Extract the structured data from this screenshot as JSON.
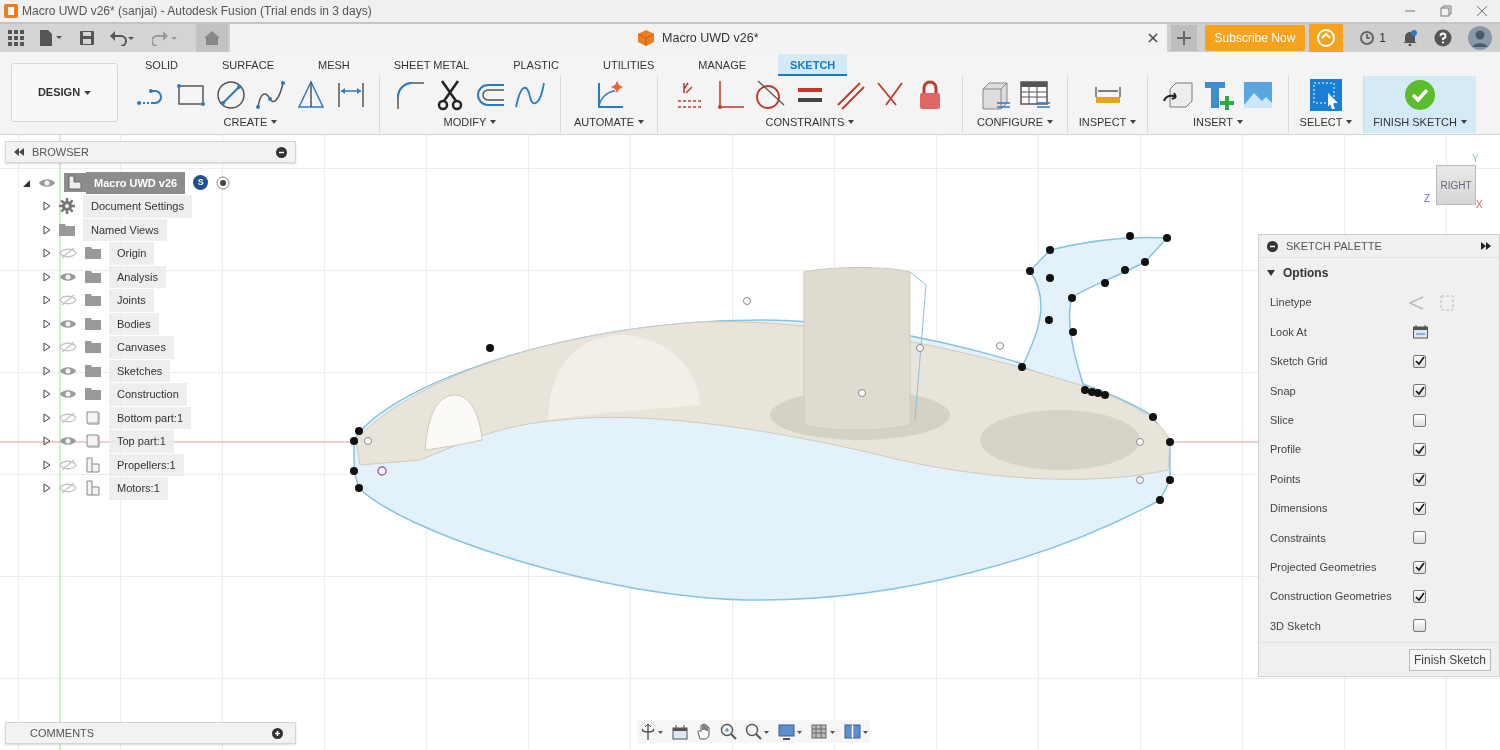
{
  "window": {
    "title": "Macro UWD v26* (sanjai) - Autodesk Fusion (Trial ends in 3 days)"
  },
  "document_tab": {
    "title": "Macro UWD v26*"
  },
  "header": {
    "subscribe": "Subscribe Now",
    "jobs_count": "1"
  },
  "workspace": {
    "label": "DESIGN"
  },
  "ribbon_tabs": [
    {
      "label": "SOLID",
      "selected": false
    },
    {
      "label": "SURFACE",
      "selected": false
    },
    {
      "label": "MESH",
      "selected": false
    },
    {
      "label": "SHEET METAL",
      "selected": false
    },
    {
      "label": "PLASTIC",
      "selected": false
    },
    {
      "label": "UTILITIES",
      "selected": false
    },
    {
      "label": "MANAGE",
      "selected": false
    },
    {
      "label": "SKETCH",
      "selected": true
    }
  ],
  "ribbon_groups": [
    {
      "label": "CREATE"
    },
    {
      "label": "MODIFY"
    },
    {
      "label": "AUTOMATE"
    },
    {
      "label": "CONSTRAINTS"
    },
    {
      "label": "CONFIGURE"
    },
    {
      "label": "INSPECT"
    },
    {
      "label": "INSERT"
    },
    {
      "label": "SELECT"
    },
    {
      "label": "FINISH SKETCH",
      "highlighted": true
    }
  ],
  "browser": {
    "title": "BROWSER",
    "root": {
      "label": "Macro UWD v26",
      "badge": "S",
      "expanded": true,
      "visible": true,
      "children": [
        {
          "label": "Document Settings",
          "kind": "settings",
          "expanded": false
        },
        {
          "label": "Named Views",
          "kind": "folder",
          "expanded": false
        },
        {
          "label": "Origin",
          "kind": "folder",
          "expanded": false,
          "visible": false
        },
        {
          "label": "Analysis",
          "kind": "folder",
          "expanded": false,
          "visible": true
        },
        {
          "label": "Joints",
          "kind": "folder",
          "expanded": false,
          "visible": false
        },
        {
          "label": "Bodies",
          "kind": "folder",
          "expanded": false,
          "visible": true
        },
        {
          "label": "Canvases",
          "kind": "folder",
          "expanded": false,
          "visible": false
        },
        {
          "label": "Sketches",
          "kind": "folder",
          "expanded": false,
          "visible": true
        },
        {
          "label": "Construction",
          "kind": "folder",
          "expanded": false,
          "visible": true
        },
        {
          "label": "Bottom part:1",
          "kind": "body",
          "expanded": false,
          "visible": false
        },
        {
          "label": "Top part:1",
          "kind": "body",
          "expanded": false,
          "visible": true
        },
        {
          "label": "Propellers:1",
          "kind": "component",
          "expanded": false,
          "visible": false
        },
        {
          "label": "Motors:1",
          "kind": "component",
          "expanded": false,
          "visible": false
        }
      ]
    }
  },
  "viewcube": {
    "face": "RIGHT",
    "axes": [
      "Y",
      "Z",
      "X"
    ]
  },
  "sketch_palette": {
    "title": "SKETCH PALETTE",
    "section": "Options",
    "expanded": true,
    "rows": [
      {
        "label": "Linetype",
        "kind": "linetype"
      },
      {
        "label": "Look At",
        "kind": "button"
      },
      {
        "label": "Sketch Grid",
        "kind": "checkbox",
        "checked": true
      },
      {
        "label": "Snap",
        "kind": "checkbox",
        "checked": true
      },
      {
        "label": "Slice",
        "kind": "checkbox",
        "checked": false
      },
      {
        "label": "Profile",
        "kind": "checkbox",
        "checked": true
      },
      {
        "label": "Points",
        "kind": "checkbox",
        "checked": true
      },
      {
        "label": "Dimensions",
        "kind": "checkbox",
        "checked": true
      },
      {
        "label": "Constraints",
        "kind": "checkbox",
        "checked": false
      },
      {
        "label": "Projected Geometries",
        "kind": "checkbox",
        "checked": true
      },
      {
        "label": "Construction Geometries",
        "kind": "checkbox",
        "checked": true
      },
      {
        "label": "3D Sketch",
        "kind": "checkbox",
        "checked": false
      }
    ],
    "button": "Finish Sketch"
  },
  "comments": {
    "title": "COMMENTS"
  }
}
